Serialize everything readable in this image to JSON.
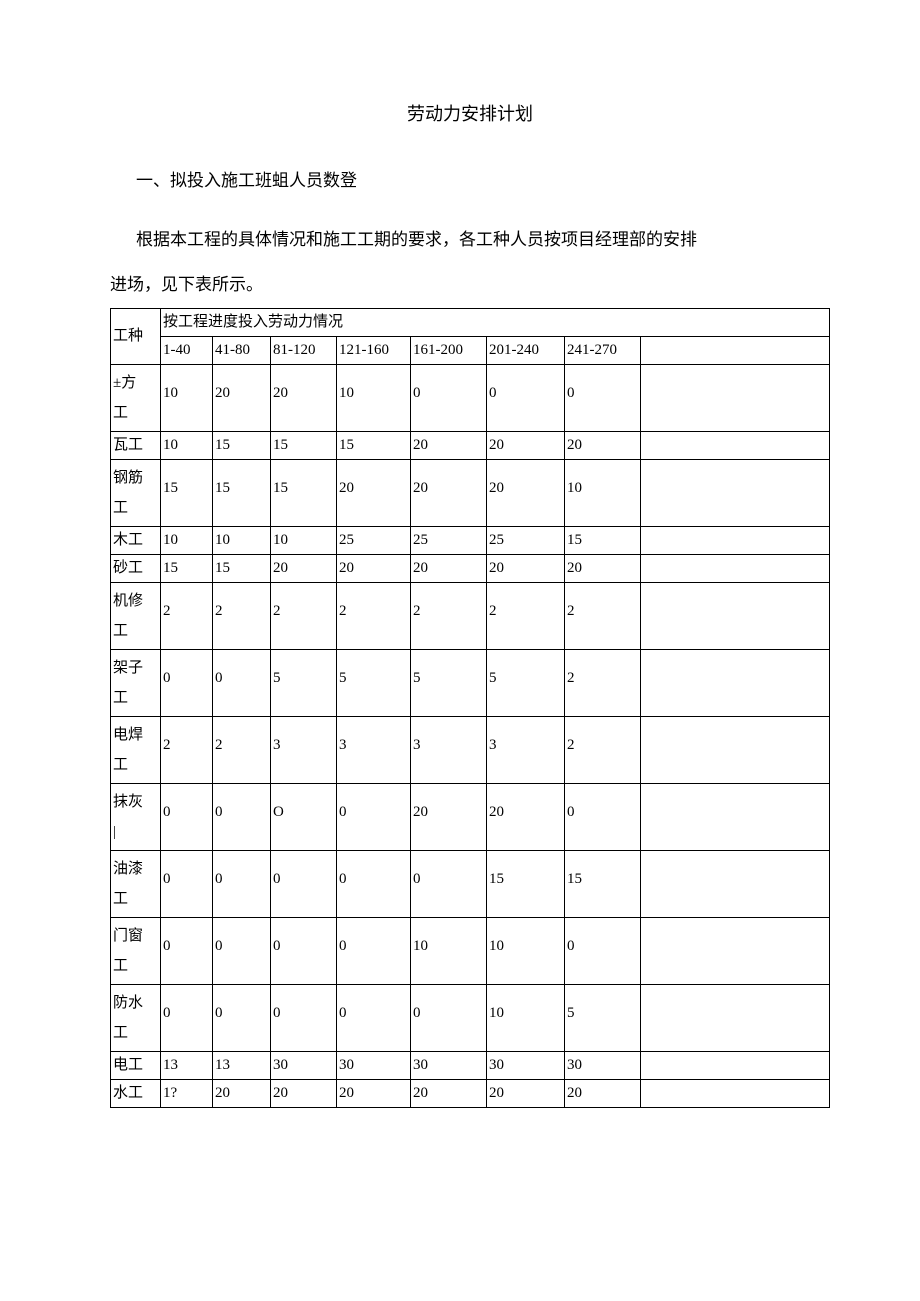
{
  "title": "劳动力安排计划",
  "section_heading": "一、拟投入施工班蛆人员数登",
  "paragraph1": "根据本工程的具体情况和施工工期的要求，各工种人员按项目经理部的安排",
  "paragraph2": "进场，见下表所示。",
  "table": {
    "work_type_label": "工种",
    "progress_header": "按工程进度投入劳动力情况",
    "periods": [
      "1-40",
      "41-80",
      "81-120",
      "121-160",
      "161-200",
      "201-240",
      "241-270"
    ],
    "rows": [
      {
        "name": "±方\n工",
        "v": [
          "10",
          "20",
          "20",
          "10",
          "0",
          "0",
          "0"
        ]
      },
      {
        "name": "瓦工",
        "v": [
          "10",
          "15",
          "15",
          "15",
          "20",
          "20",
          "20"
        ]
      },
      {
        "name": "钢筋\n工",
        "v": [
          "15",
          "15",
          "15",
          "20",
          "20",
          "20",
          "10"
        ]
      },
      {
        "name": "木工",
        "v": [
          "10",
          "10",
          "10",
          "25",
          "25",
          "25",
          "15"
        ]
      },
      {
        "name": "砂工",
        "v": [
          "15",
          "15",
          "20",
          "20",
          "20",
          "20",
          "20"
        ]
      },
      {
        "name": "机修\n工",
        "v": [
          "2",
          "2",
          "2",
          "2",
          "2",
          "2",
          "2"
        ]
      },
      {
        "name": "架子\n工",
        "v": [
          "0",
          "0",
          "5",
          "5",
          "5",
          "5",
          "2"
        ]
      },
      {
        "name": "电焊\n工",
        "v": [
          "2",
          "2",
          "3",
          "3",
          "3",
          "3",
          "2"
        ]
      },
      {
        "name": "抹灰\n|",
        "v": [
          "0",
          "0",
          "O",
          "0",
          "20",
          "20",
          "0"
        ]
      },
      {
        "name": "油漆\n工",
        "v": [
          "0",
          "0",
          "0",
          "0",
          "0",
          "15",
          "15"
        ]
      },
      {
        "name": "门窗\n工",
        "v": [
          "0",
          "0",
          "0",
          "0",
          "10",
          "10",
          "0"
        ]
      },
      {
        "name": "防水\n工",
        "v": [
          "0",
          "0",
          "0",
          "0",
          "0",
          "10",
          "5"
        ]
      },
      {
        "name": "电工",
        "v": [
          "13",
          "13",
          "30",
          "30",
          "30",
          "30",
          "30"
        ]
      },
      {
        "name": "水工",
        "v": [
          "1?",
          "20",
          "20",
          "20",
          "20",
          "20",
          "20"
        ]
      }
    ]
  }
}
